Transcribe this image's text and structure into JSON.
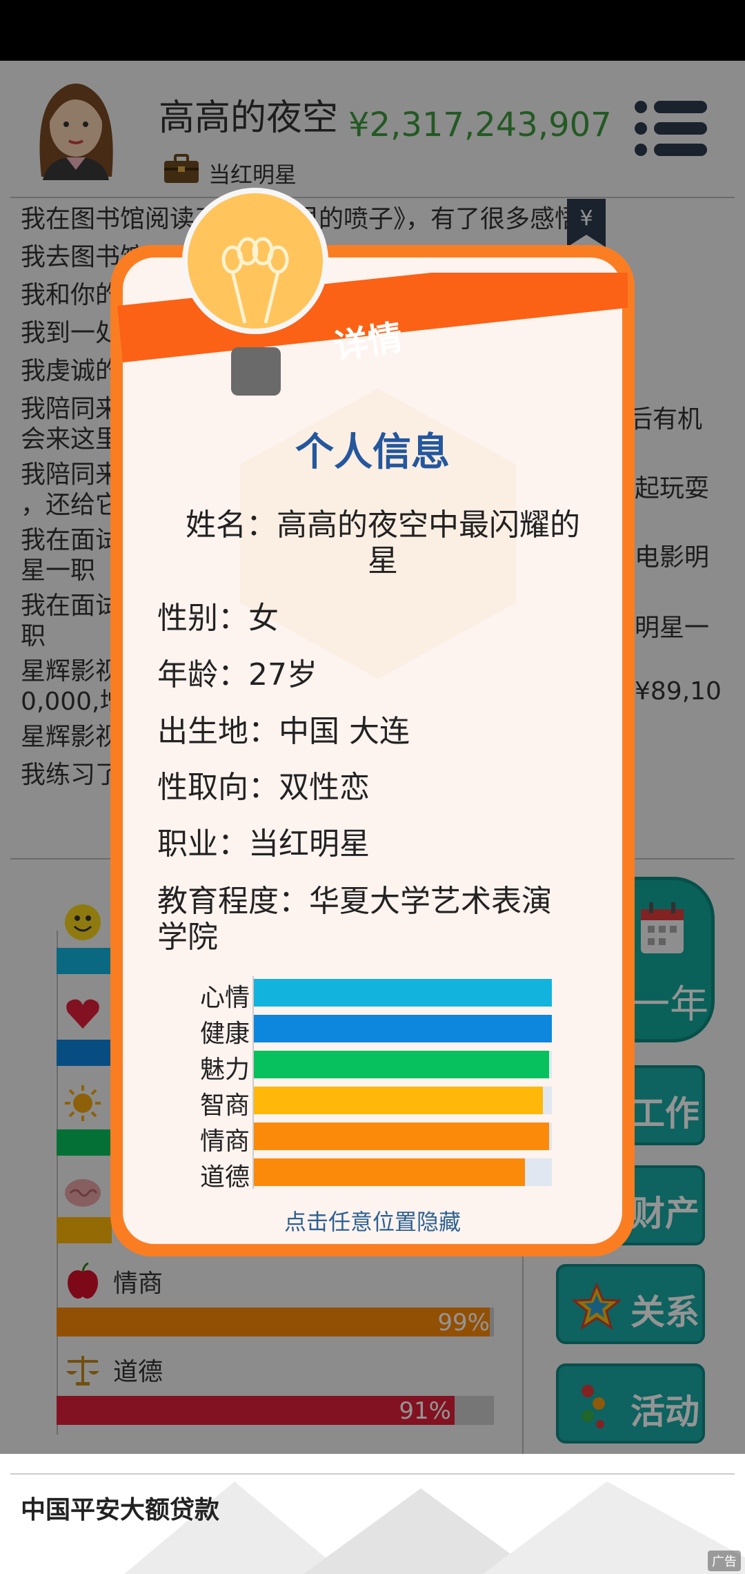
{
  "header": {
    "player_name": "高高的夜空",
    "money": "¥2,317,243,907",
    "job": "当红明星"
  },
  "log": [
    "我在图书馆阅读了《麦田里的喷子》，有了很多感悟",
    "我去图书馆",
    "我和你的",
    "我到一处",
    "我虔诚的",
    "我陪同来…后有机会来这里",
    "我陪同…起玩耍，还给它",
    "我在面试…电影明星一职",
    "我在面试…明星一职",
    "星辉影视…¥89,100,000,增",
    "星辉影视",
    "我练习了"
  ],
  "log_visible": [
    "我在图书馆阅读了《麦田里的喷子》，有了很多感悟",
    "我去图书馆",
    "我和你的",
    "我到一处",
    "我虔诚的",
    "我陪同来",
    "会来这里",
    "我陪同来",
    "，还给它",
    "我在面试",
    "星一职",
    "我在面试",
    "职",
    "星辉影视",
    "0,000,增",
    "星辉影视",
    "我练习了"
  ],
  "log_right": {
    "l6": "后有机",
    "l7": "起玩耍",
    "l8": "电影明",
    "l9": "明星一",
    "l10": "¥89,10"
  },
  "stats": {
    "eq_label": "情商",
    "eq_pct_text": "99%",
    "eq_value": 99,
    "moral_label": "道德",
    "moral_pct_text": "91%",
    "moral_value": 91
  },
  "buttons": {
    "next_year": "一年",
    "work": "工作",
    "assets": "财产",
    "relations": "关系",
    "activities": "活动"
  },
  "ad": {
    "title": "中国平安大额贷款",
    "tag": "广告"
  },
  "modal": {
    "ribbon": "详情",
    "title": "个人信息",
    "name_line": "姓名：高高的夜空中最闪耀的星",
    "name_line_1": "姓名：高高的夜空中最闪耀的",
    "name_line_2": "星",
    "gender": "性别：女",
    "age": "年龄：27岁",
    "birthplace": "出生地：中国 大连",
    "orientation": "性取向：双性恋",
    "occupation": "职业：当红明星",
    "education_1": "教育程度：华夏大学艺术表演",
    "education_2": "学院",
    "bars": [
      {
        "label": "心情",
        "value": 100,
        "color": "#12b3dd"
      },
      {
        "label": "健康",
        "value": 100,
        "color": "#0d86de"
      },
      {
        "label": "魅力",
        "value": 99,
        "color": "#07c15e"
      },
      {
        "label": "智商",
        "value": 97,
        "color": "#ffb70a"
      },
      {
        "label": "情商",
        "value": 99,
        "color": "#fb8a0a"
      },
      {
        "label": "道德",
        "value": 91,
        "color": "#fb8a0a"
      }
    ],
    "hint": "点击任意位置隐藏"
  },
  "colors": {
    "accent_orange": "#fb7d22",
    "money_green": "#3d9a3d",
    "title_blue": "#23579e",
    "button_teal": "#19a9a4"
  }
}
